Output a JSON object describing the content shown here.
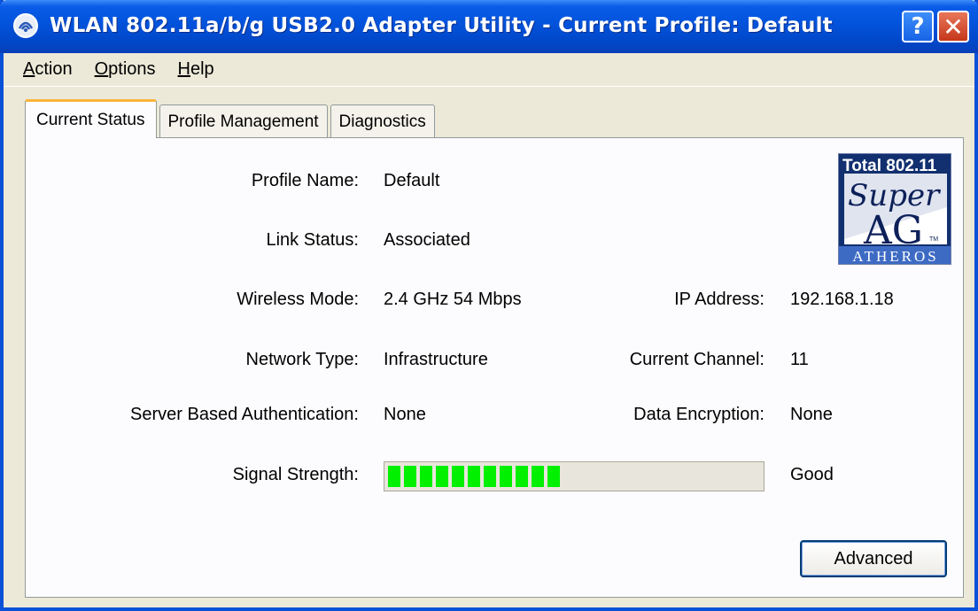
{
  "window": {
    "title": "WLAN 802.11a/b/g USB2.0 Adapter Utility - Current Profile: Default",
    "help_label": "?",
    "close_label": "✕"
  },
  "menu": [
    {
      "accel": "A",
      "rest": "ction"
    },
    {
      "accel": "O",
      "rest": "ptions"
    },
    {
      "accel": "H",
      "rest": "elp"
    }
  ],
  "tabs": [
    "Current Status",
    "Profile Management",
    "Diagnostics"
  ],
  "status": {
    "profile_name_label": "Profile Name:",
    "profile_name_value": "Default",
    "link_status_label": "Link Status:",
    "link_status_value": "Associated",
    "wireless_mode_label": "Wireless Mode:",
    "wireless_mode_value": "2.4 GHz 54 Mbps",
    "network_type_label": "Network Type:",
    "network_type_value": "Infrastructure",
    "server_auth_label": "Server Based Authentication:",
    "server_auth_value": "None",
    "signal_label": "Signal Strength:",
    "signal_value": "Good",
    "signal_level": 0.5,
    "ip_label": "IP Address:",
    "ip_value": "192.168.1.18",
    "channel_label": "Current Channel:",
    "channel_value": "11",
    "encryption_label": "Data Encryption:",
    "encryption_value": "None"
  },
  "logo": {
    "line1": "Total 802.11",
    "line2": "Super",
    "line3": "AG",
    "tm": "TM",
    "brand": "ATHEROS"
  },
  "buttons": {
    "advanced": "Advanced"
  },
  "colors": {
    "signal": "#00f000",
    "titlebar": "#0054e3",
    "tab_highlight": "#f9b43a"
  }
}
